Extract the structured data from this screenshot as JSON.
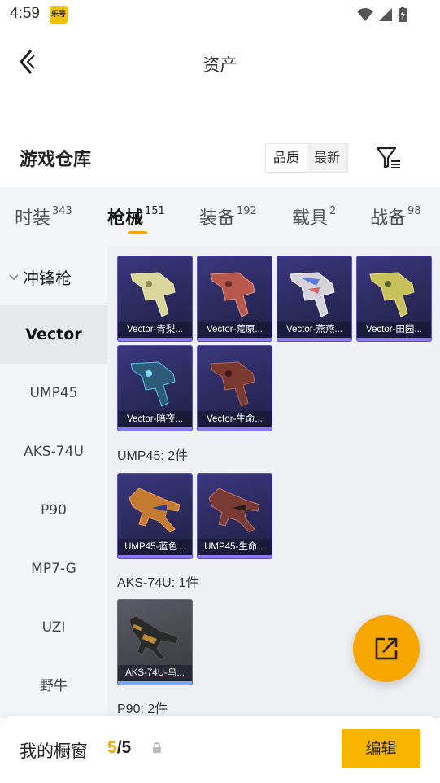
{
  "status_bar": {
    "time": "4:59",
    "app_icon_text": "乐号"
  },
  "header": {
    "title": "资产"
  },
  "warehouse": {
    "title": "游戏仓库",
    "sort_options": [
      "品质",
      "最新"
    ]
  },
  "tabs": [
    {
      "label": "时装",
      "count": "343"
    },
    {
      "label": "枪械",
      "count": "151",
      "active": true
    },
    {
      "label": "装备",
      "count": "192"
    },
    {
      "label": "载具",
      "count": "2"
    },
    {
      "label": "战备",
      "count": "98"
    }
  ],
  "sidebar": {
    "group": "冲锋枪",
    "items": [
      "Vector",
      "UMP45",
      "AKS-74U",
      "P90",
      "MP7-G",
      "UZI",
      "野牛"
    ],
    "active": "Vector"
  },
  "sections": {
    "vector": {
      "items": [
        "Vector-青梨...",
        "Vector-荒原...",
        "Vector-燕燕...",
        "Vector-田园...",
        "Vector-暗夜...",
        "Vector-生命..."
      ]
    },
    "ump45": {
      "title": "UMP45: 2件",
      "items": [
        "UMP45-蓝色...",
        "UMP45-生命..."
      ]
    },
    "aks74u": {
      "title": "AKS-74U: 1件",
      "items": [
        "AKS-74U-乌..."
      ]
    },
    "p90": {
      "title": "P90: 2件"
    }
  },
  "bottom_bar": {
    "label": "我的橱窗",
    "current": "5",
    "total": "/5",
    "edit_label": "编辑"
  },
  "colors": {
    "accent": "#f7b500",
    "card_purple": "#2b2a5c",
    "card_gray": "#45464e"
  }
}
